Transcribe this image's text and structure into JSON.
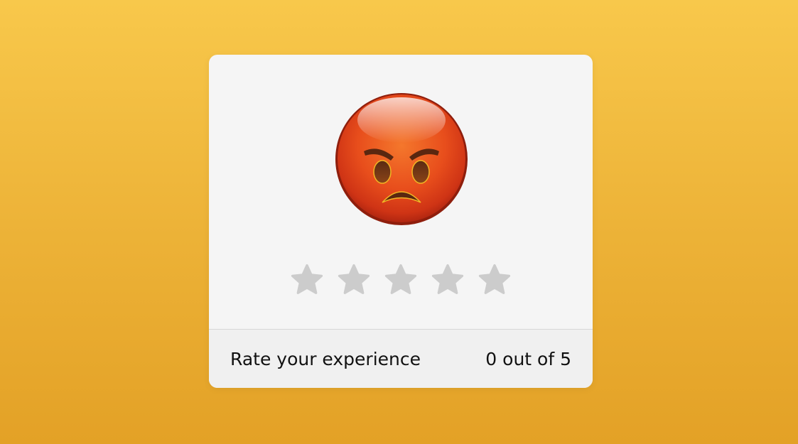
{
  "card": {
    "emoji": {
      "icon": "angry-face-icon",
      "face_color": "#e84e1c",
      "highlight_color": "#f7b7a0"
    },
    "rating": {
      "value": 0,
      "max": 5,
      "star_icon": "star-icon",
      "star_empty_color": "#cccccc"
    },
    "footer": {
      "prompt": "Rate your experience",
      "score_text": "0 out of 5"
    }
  },
  "colors": {
    "background_top": "#f8c84b",
    "background_bottom": "#e3a126",
    "card_background": "#f5f5f5"
  }
}
